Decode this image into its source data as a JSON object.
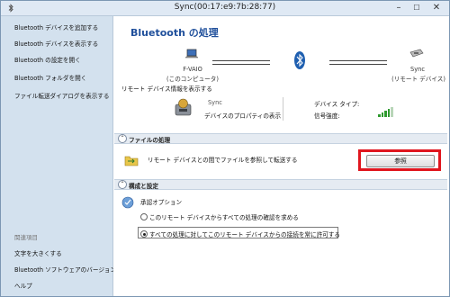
{
  "window": {
    "title": "Sync(00:17:e9:7b:28:77)",
    "minimize": "–",
    "maximize": "☐",
    "close": "✕"
  },
  "sidebar": {
    "items": [
      "Bluetooth デバイスを追加する",
      "Bluetooth デバイスを表示する",
      "Bluetooth の設定を開く",
      "Bluetooth フォルダを開く",
      "ファイル転送ダイアログを表示する"
    ],
    "related_title": "関連項目",
    "related_items": [
      "文字を大きくする",
      "Bluetooth ソフトウェアのバージョン情報",
      "ヘルプ"
    ]
  },
  "main": {
    "heading": "Bluetooth の処理",
    "local_device": {
      "name": "F-VAIO",
      "sub": "(このコンピュータ)"
    },
    "remote_device": {
      "name": "Sync",
      "sub": "(リモート デバイス)"
    },
    "remote_info_link": "リモート デバイス情報を表示する",
    "sync": {
      "name": "Sync",
      "props_link": "デバイスのプロパティの表示",
      "type_label": "デバイス タイプ:",
      "signal_label": "信号強度:"
    },
    "file_section": {
      "title": "ファイルの処理",
      "description": "リモート デバイスとの間でファイルを参照して転送する",
      "browse_label": "参照"
    },
    "config_section": {
      "title": "構成と設定",
      "approval_title": "承認オプション",
      "option1": "このリモート デバイスからすべての処理の確認を求める",
      "option2": "すべての処理に対してこのリモート デバイスからの接続を常に許可する"
    }
  },
  "colors": {
    "accent": "#1f4f9b",
    "link": "#1a57c4",
    "highlight": "#e0161e",
    "signal": "#2e9a2e"
  },
  "signal_strength": 0.8
}
